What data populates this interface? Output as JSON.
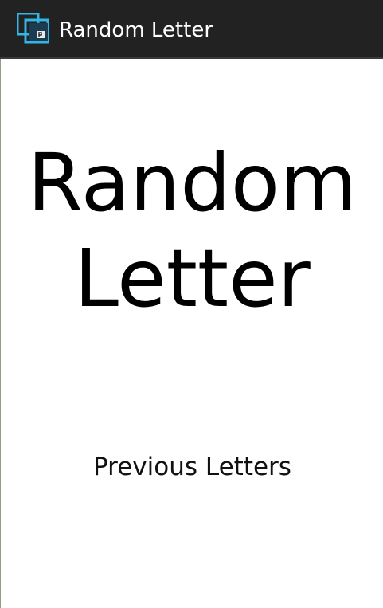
{
  "action_bar": {
    "title": "Random Letter",
    "icon": "app-windows-icon",
    "background": "#222222",
    "title_color": "#ffffff",
    "icon_accent": "#33b5e5"
  },
  "main": {
    "letter_display": "Random Letter",
    "previous_button_label": "Previous Letters",
    "background": "#ffffff",
    "text_color": "#000000"
  }
}
